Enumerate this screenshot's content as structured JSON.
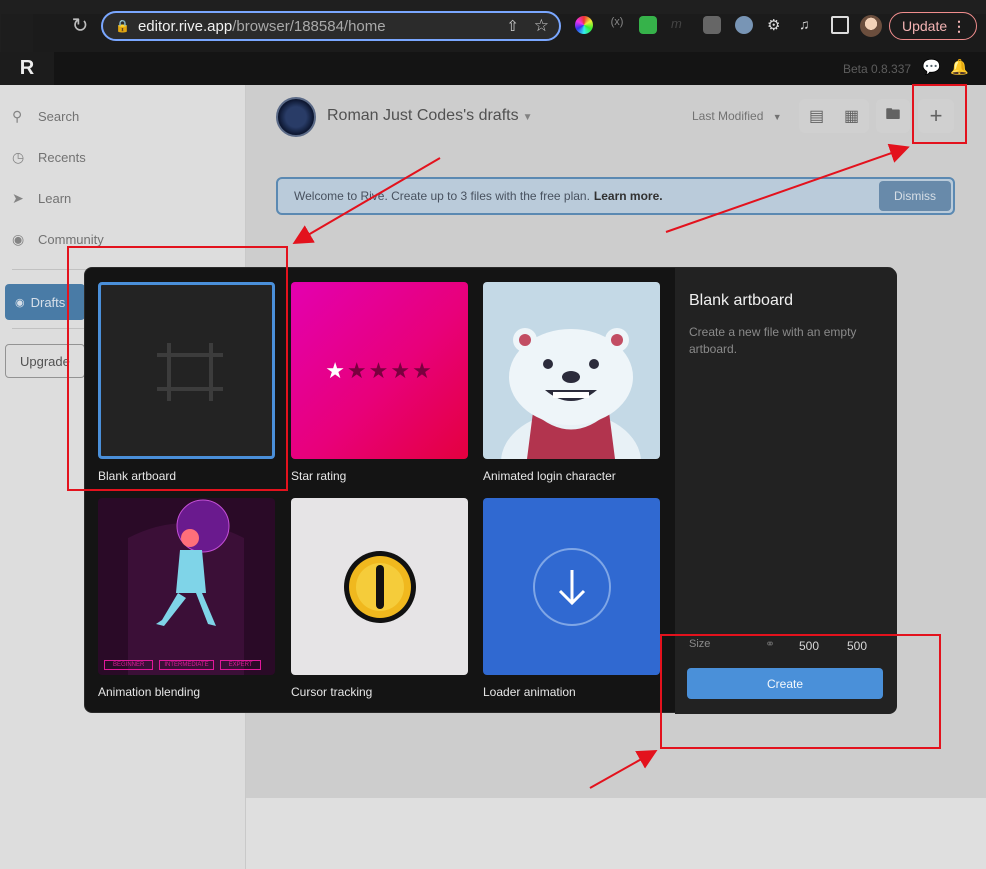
{
  "browser": {
    "url_host": "editor.rive.app",
    "url_path": "/browser/188584/home",
    "update_label": "Update"
  },
  "app": {
    "logo": "R",
    "version": "Beta 0.8.337"
  },
  "sidebar": {
    "items": [
      {
        "label": "Search",
        "icon": "search-icon"
      },
      {
        "label": "Recents",
        "icon": "clock-icon"
      },
      {
        "label": "Learn",
        "icon": "rocket-icon"
      },
      {
        "label": "Community",
        "icon": "globe-icon"
      }
    ],
    "drafts_label": "Drafts",
    "upgrade_label": "Upgrade"
  },
  "header": {
    "team_name": "Roman Just Codes's drafts",
    "sort_label": "Last Modified"
  },
  "banner": {
    "text": "Welcome to Rive. Create up to 3 files with the free plan.",
    "link": "Learn more.",
    "dismiss_label": "Dismiss"
  },
  "modal": {
    "templates": [
      {
        "label": "Blank artboard",
        "selected": true
      },
      {
        "label": "Star rating"
      },
      {
        "label": "Animated login character"
      },
      {
        "label": "Animation blending",
        "chips": [
          "BEGINNER",
          "INTERMEDIATE",
          "EXPERT"
        ]
      },
      {
        "label": "Cursor tracking"
      },
      {
        "label": "Loader animation"
      }
    ],
    "panel": {
      "title": "Blank artboard",
      "description": "Create a new file with an empty artboard.",
      "size_label": "Size",
      "width": "500",
      "height": "500",
      "create_label": "Create"
    }
  },
  "colors": {
    "accent": "#4a90d9",
    "annotation": "#e3121d"
  }
}
